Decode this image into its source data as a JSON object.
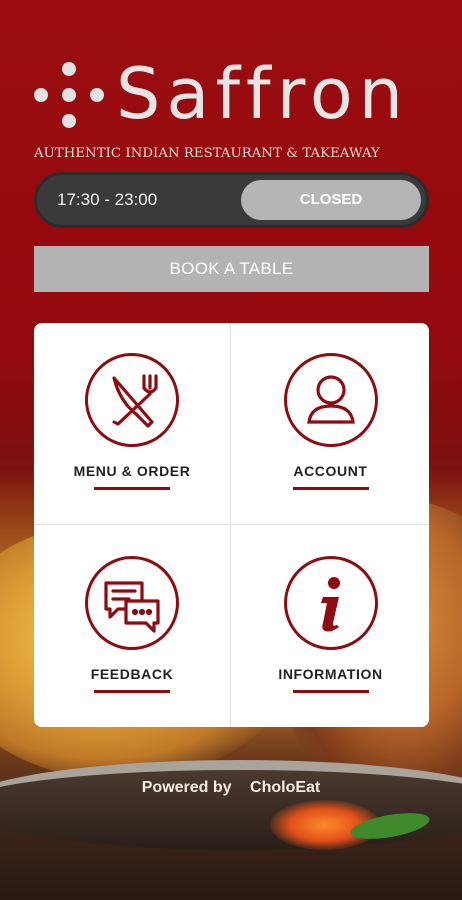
{
  "brand": {
    "name": "Saffron",
    "tagline": "AUTHENTIC INDIAN RESTAURANT & TAKEAWAY",
    "logo_icon": "dot-cross-icon"
  },
  "hours": {
    "time": "17:30 - 23:00",
    "status": "CLOSED"
  },
  "book_table": {
    "label": "BOOK A TABLE"
  },
  "tiles": [
    {
      "label": "MENU & ORDER",
      "icon": "fork-knife-icon"
    },
    {
      "label": "ACCOUNT",
      "icon": "user-icon"
    },
    {
      "label": "FEEDBACK",
      "icon": "chat-bubbles-icon"
    },
    {
      "label": "INFORMATION",
      "icon": "info-icon"
    }
  ],
  "footer": {
    "powered_by": "Powered by",
    "provider": "CholoEat"
  },
  "colors": {
    "brand_red": "#8f0b10",
    "pill_dark": "#3a3a3a",
    "button_grey": "#b3b3b3"
  }
}
